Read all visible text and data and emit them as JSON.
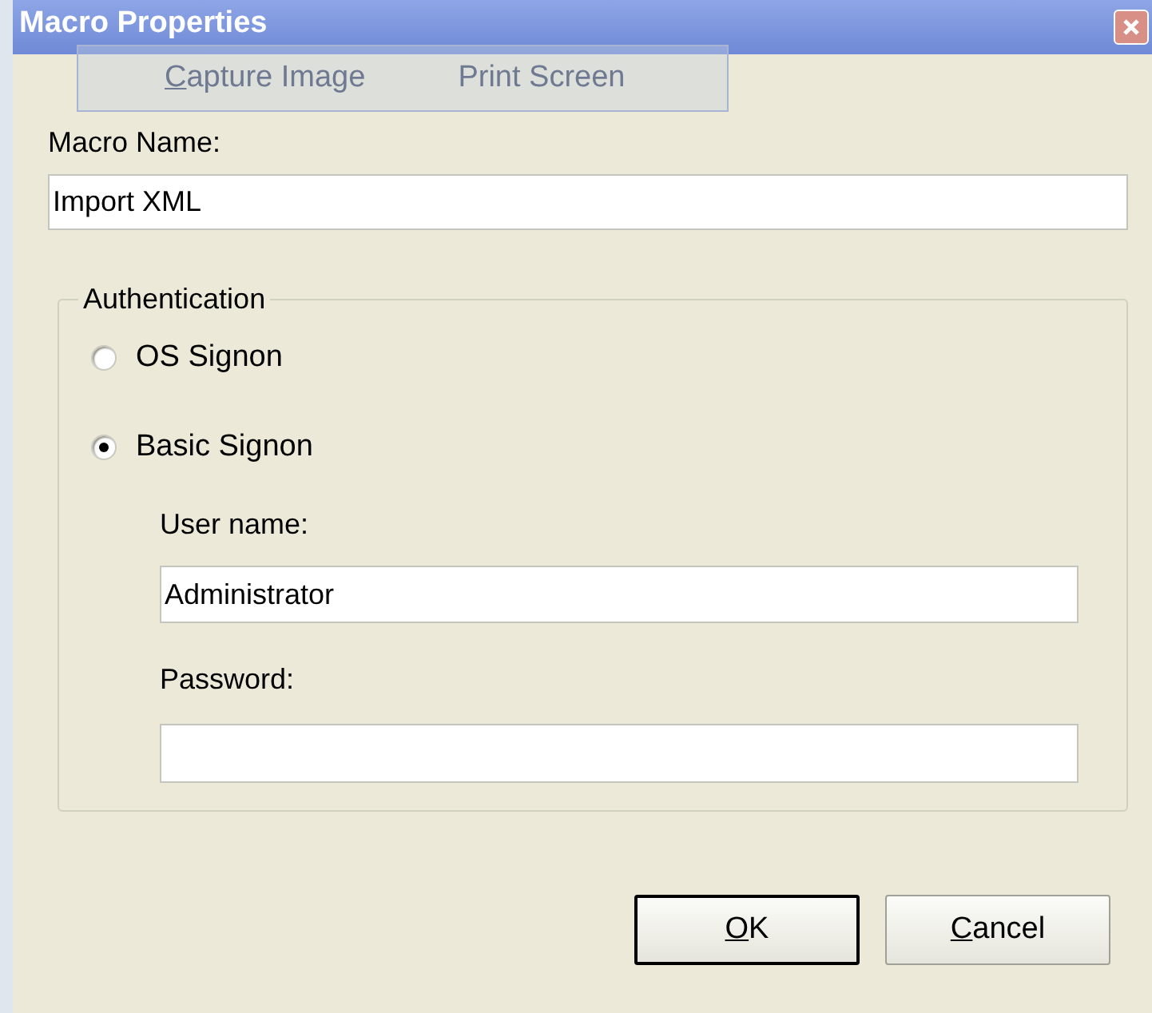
{
  "window": {
    "title": "Macro Properties"
  },
  "capture_toolbar": {
    "items": [
      {
        "label": "Capture Image",
        "underline_first": true
      },
      {
        "label": "Print Screen",
        "underline_first": false
      }
    ]
  },
  "macro_name": {
    "label": "Macro Name:",
    "value": "Import XML"
  },
  "authentication": {
    "title": "Authentication",
    "options": [
      {
        "label": "OS Signon",
        "selected": false
      },
      {
        "label": "Basic Signon",
        "selected": true
      }
    ],
    "user_name": {
      "label": "User name:",
      "value": "Administrator"
    },
    "password": {
      "label": "Password:"
    }
  },
  "buttons": [
    {
      "label": "OK",
      "default": true
    },
    {
      "label": "Cancel",
      "default": false
    }
  ]
}
